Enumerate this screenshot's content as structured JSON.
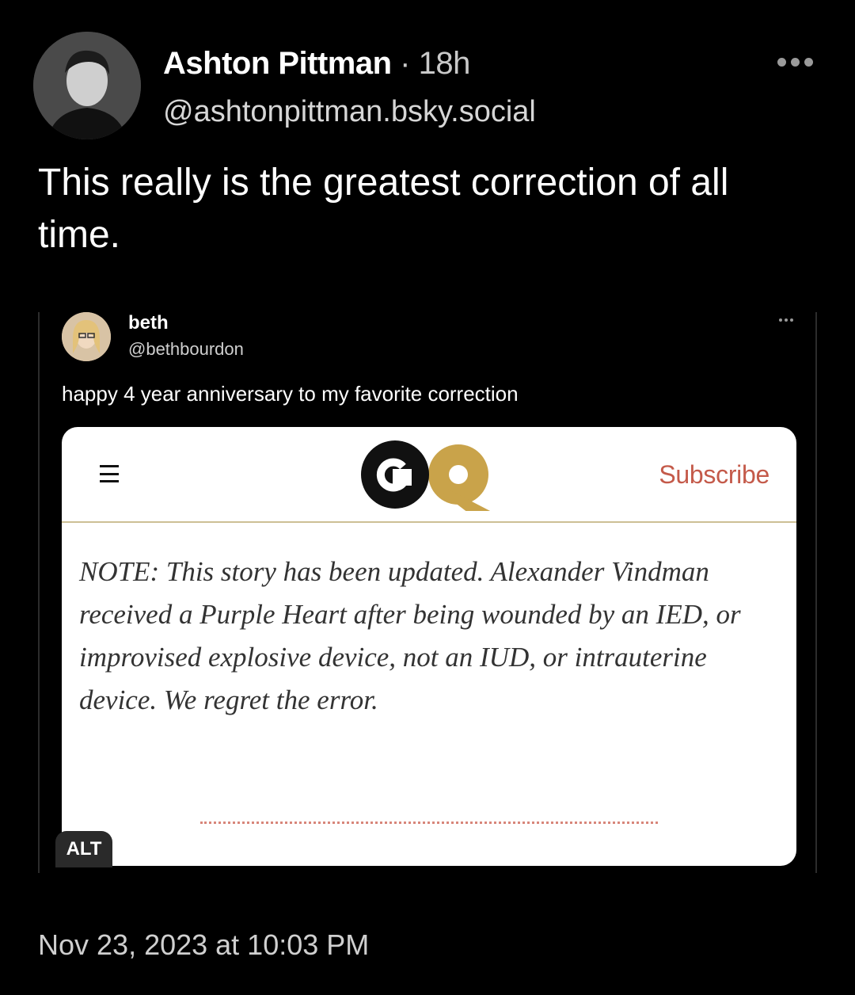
{
  "post": {
    "author_name": "Ashton Pittman",
    "separator": "·",
    "age": "18h",
    "handle": "@ashtonpittman.bsky.social",
    "text": "This really is the greatest correction of all time.",
    "timestamp": "Nov 23, 2023 at 10:03 PM"
  },
  "embed": {
    "author_name": "beth",
    "handle": "@bethbourdon",
    "text": "happy 4 year anniversary to my favorite correction",
    "alt_label": "ALT",
    "image": {
      "logo_text": "GQ",
      "subscribe_label": "Subscribe",
      "note": "NOTE: This story has been updated. Alexander Vindman received a Purple Heart after being wounded by an IED, or improvised explosive device, not an IUD, or intrauterine device. We regret the error."
    }
  },
  "colors": {
    "background": "#000000",
    "gq_gold": "#c9a34a",
    "subscribe_red": "#c45a4a"
  },
  "icons": [
    "more-options-icon",
    "hamburger-menu-icon"
  ]
}
